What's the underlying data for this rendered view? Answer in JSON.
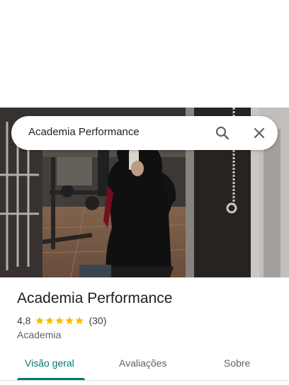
{
  "search": {
    "query": "Academia Performance"
  },
  "place": {
    "name": "Academia Performance",
    "rating": "4,8",
    "rating_value": 4.8,
    "review_count": "(30)",
    "category": "Academia"
  },
  "tabs": [
    {
      "label": "Visão geral",
      "active": true
    },
    {
      "label": "Avaliações",
      "active": false
    },
    {
      "label": "Sobre",
      "active": false
    }
  ],
  "colors": {
    "accent": "#00796b",
    "star": "#fbbc04"
  },
  "icons": [
    "search-icon",
    "close-icon",
    "star-icon"
  ]
}
